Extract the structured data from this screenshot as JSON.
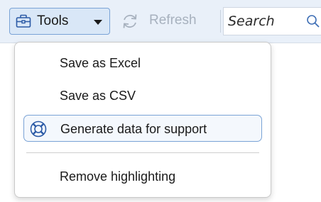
{
  "toolbar": {
    "tools_label": "Tools",
    "refresh_label": "Refresh",
    "search_placeholder": "Search"
  },
  "menu": {
    "items": [
      {
        "label": "Save as Excel",
        "icon": null
      },
      {
        "label": "Save as CSV",
        "icon": null
      },
      {
        "label": "Generate data for support",
        "icon": "lifebuoy-icon",
        "highlighted": true
      },
      {
        "label": "Remove highlighting",
        "icon": null
      }
    ]
  },
  "colors": {
    "toolbar_bg": "#e9f0f9",
    "accent_border": "#7aa3d6",
    "disabled_text": "#a7b1be"
  }
}
